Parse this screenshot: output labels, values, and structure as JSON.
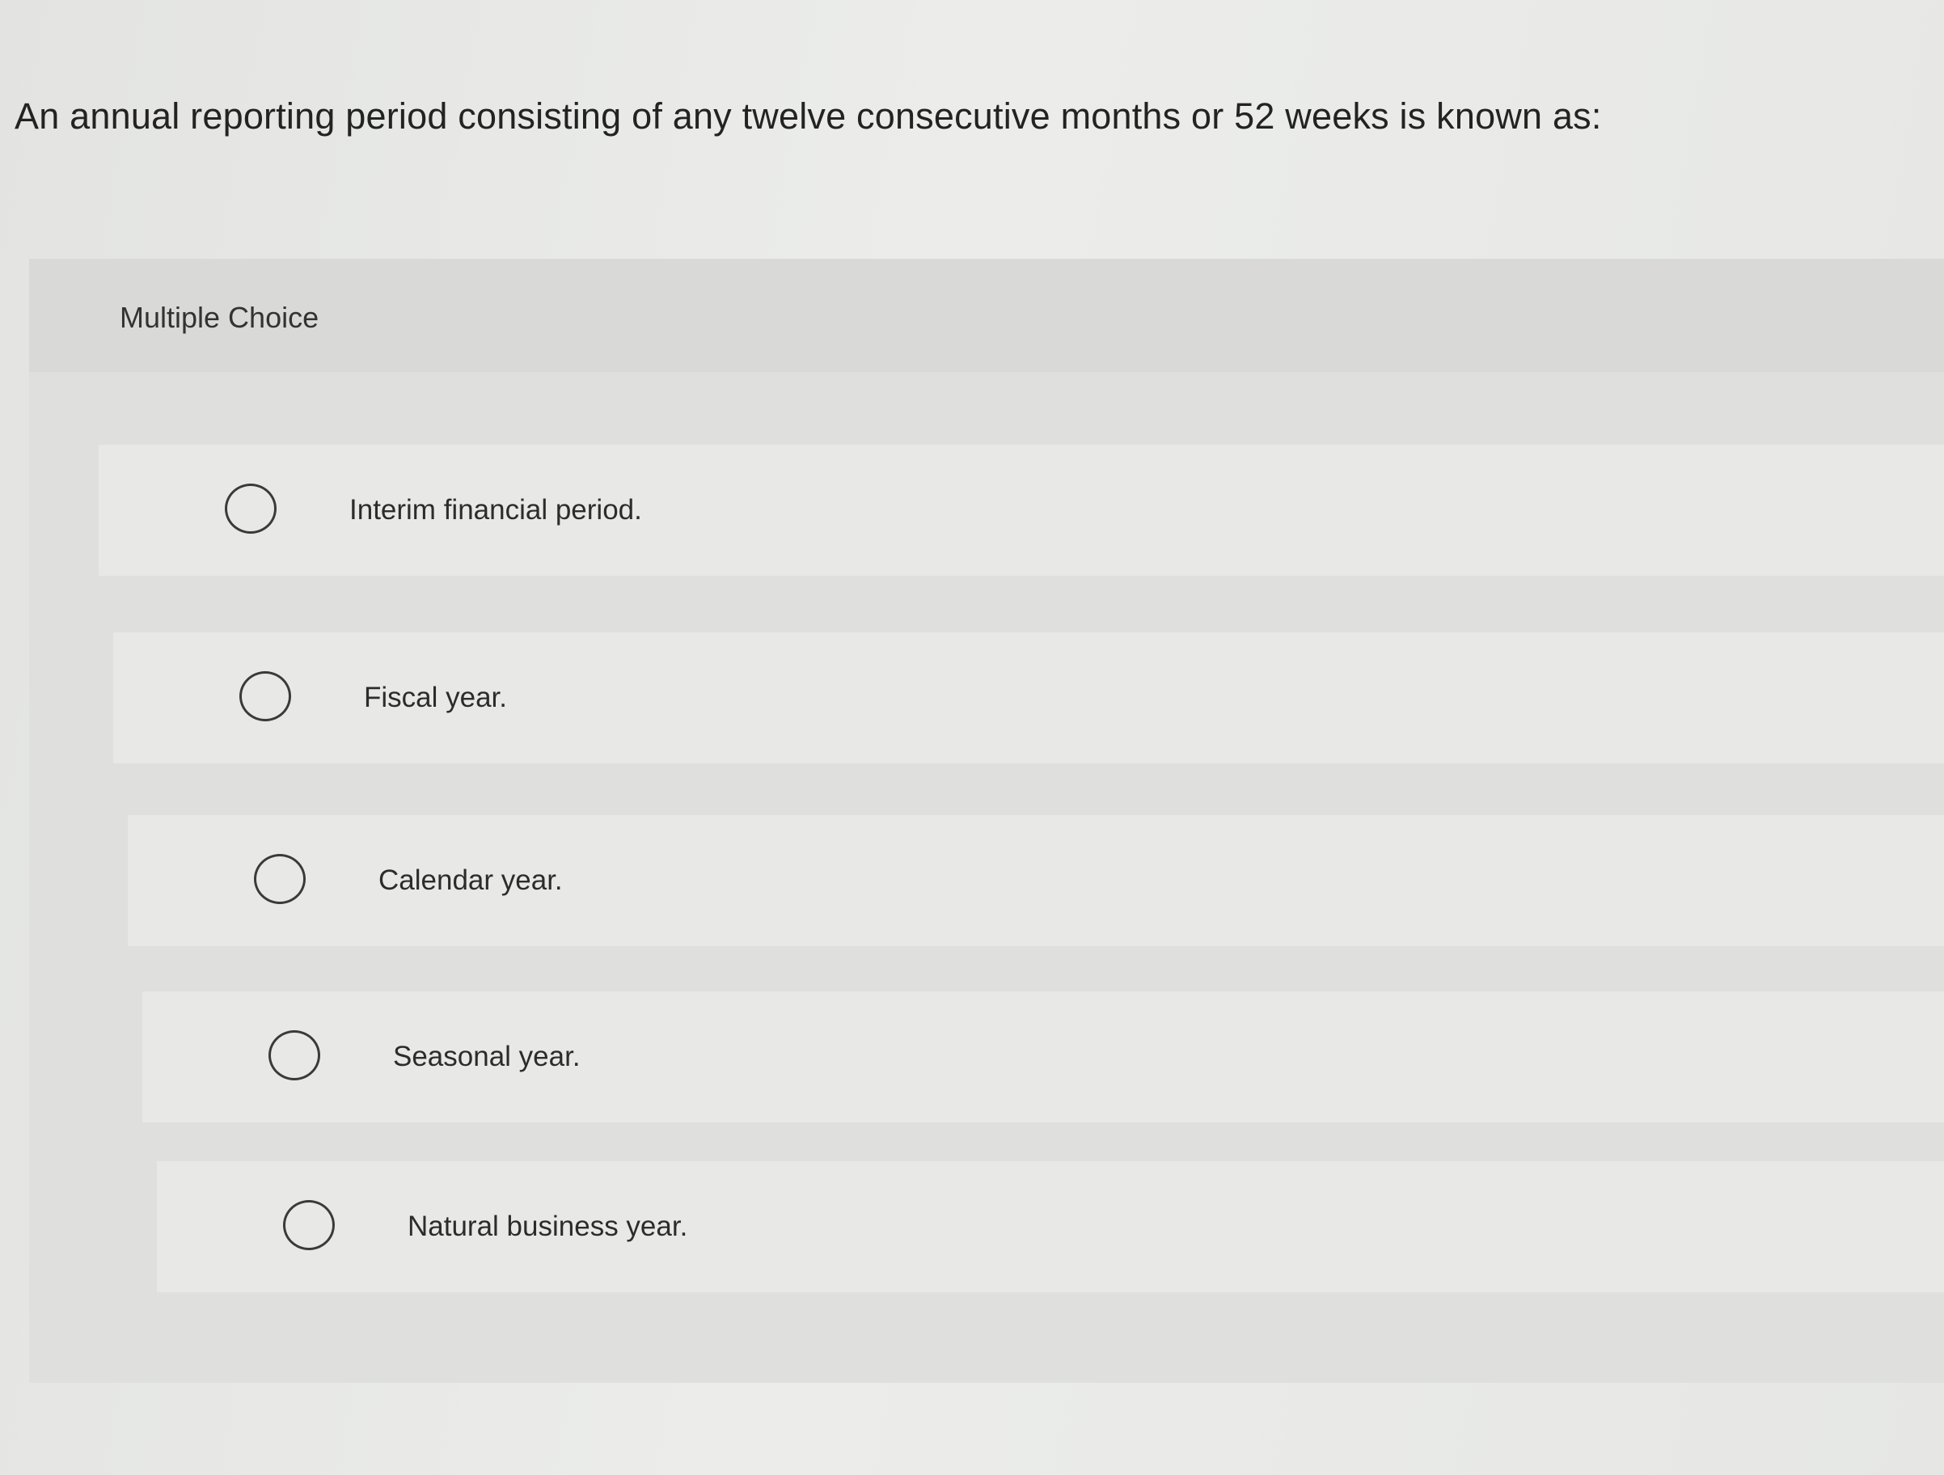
{
  "question": {
    "text": "An annual reporting period consisting of any twelve consecutive months or 52 weeks is known as:"
  },
  "panel": {
    "title": "Multiple Choice"
  },
  "options": [
    {
      "label": "Interim financial period.",
      "selected": false
    },
    {
      "label": "Fiscal year.",
      "selected": false
    },
    {
      "label": "Calendar year.",
      "selected": false
    },
    {
      "label": "Seasonal year.",
      "selected": false
    },
    {
      "label": "Natural business year.",
      "selected": false
    }
  ],
  "colors": {
    "background": "#e6e7e5",
    "panel": "#dfe0de",
    "option_background": "#e8e9e7",
    "text": "#2a2a2a",
    "radio_border": "#3a3a3a"
  }
}
